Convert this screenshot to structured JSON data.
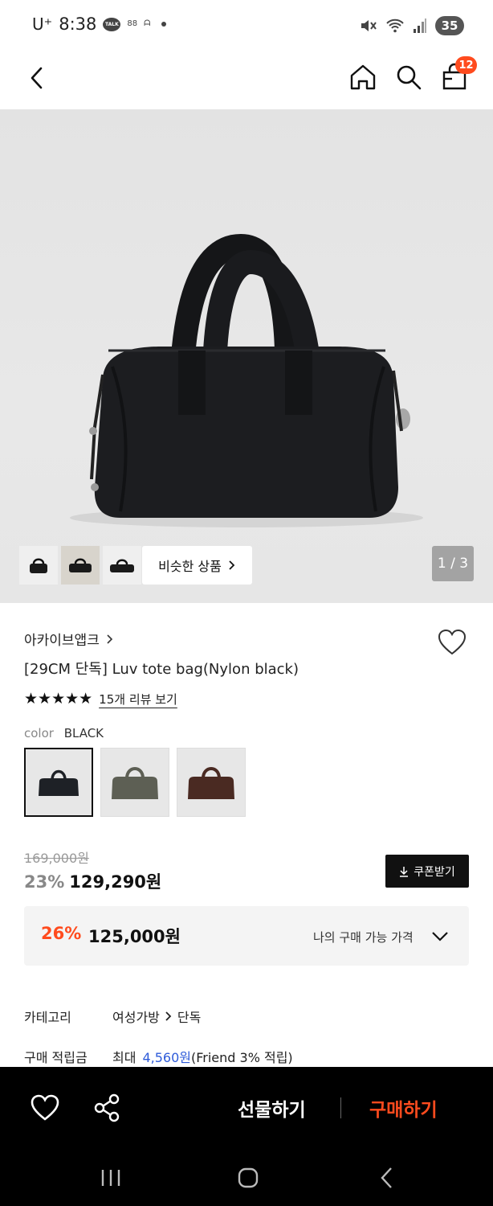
{
  "status_bar": {
    "carrier": "U⁺",
    "time": "8:38",
    "talk_badge": "TALK",
    "battery": "35"
  },
  "nav": {
    "cart_count": "12"
  },
  "gallery": {
    "similar_label": "비슷한 상품",
    "page_indicator": "1 / 3"
  },
  "product": {
    "brand": "아카이브앱크",
    "title": "[29CM 단독] Luv tote bag(Nylon black)",
    "stars": "★★★★★",
    "review_link": "15개 리뷰 보기",
    "color_label": "color",
    "color_value": "BLACK",
    "swatch_colors": [
      "#1e2126",
      "#5d5f54",
      "#4a2a22"
    ]
  },
  "price": {
    "original": "169,000원",
    "discount_rate": "23%",
    "discount_price": "129,290원",
    "coupon_label": "쿠폰받기",
    "best_rate": "26%",
    "best_price": "125,000원",
    "best_label": "나의 구매 가능 가격"
  },
  "details": {
    "category_key": "카테고리",
    "category_main": "여성가방",
    "category_sub": "단독",
    "points_key": "구매 적립금",
    "points_prefix": "최대",
    "points_amount": "4,560원",
    "points_suffix": "(Friend 3% 적립)"
  },
  "bottom": {
    "gift_label": "선물하기",
    "buy_label": "구매하기"
  },
  "colors": {
    "accent": "#ff4b1e",
    "link_blue": "#2e5bd9"
  }
}
